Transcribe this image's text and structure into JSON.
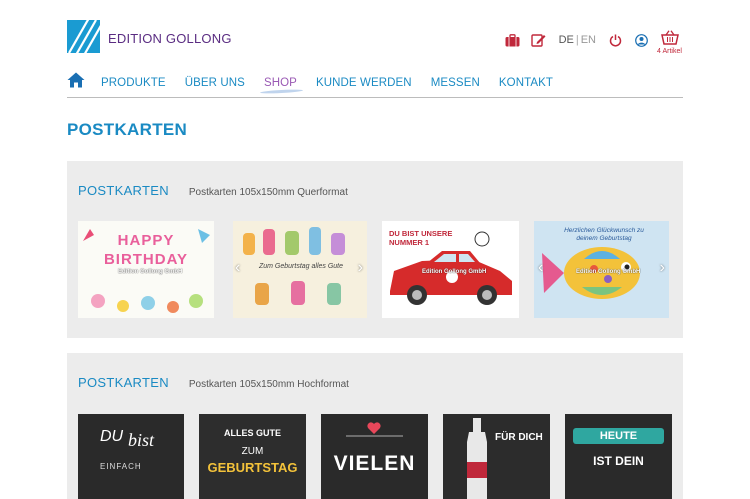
{
  "brand": {
    "name": "EDITION GOLLONG"
  },
  "header": {
    "lang_active": "DE",
    "lang_sep": "|",
    "lang_inactive": "EN",
    "cart_count": "4 Artikel"
  },
  "nav": {
    "items": [
      {
        "label": "PRODUKTE"
      },
      {
        "label": "ÜBER UNS"
      },
      {
        "label": "SHOP"
      },
      {
        "label": "KUNDE WERDEN"
      },
      {
        "label": "MESSEN"
      },
      {
        "label": "KONTAKT"
      }
    ]
  },
  "page": {
    "title": "POSTKARTEN"
  },
  "sections": [
    {
      "title": "POSTKARTEN",
      "subtitle": "Postkarten 105x150mm Querformat",
      "cards": [
        {
          "text": "HAPPY BIRTHDAY",
          "watermark": "Edition Gollong GmbH"
        },
        {
          "text": "Zum Geburtstag alles Gute",
          "watermark": "Edition Gollong GmbH"
        },
        {
          "text": "DU BIST UNSERE NUMMER 1",
          "watermark": "Edition Gollong GmbH"
        },
        {
          "text": "Herzlichen Glückwunsch zu deinem Geburtstag",
          "watermark": "Edition Gollong GmbH"
        }
      ]
    },
    {
      "title": "POSTKARTEN",
      "subtitle": "Postkarten 105x150mm Hochformat",
      "cards": [
        {
          "text1": "DU",
          "text2": "bist",
          "text3": "EINFACH"
        },
        {
          "text1": "ALLES GUTE",
          "text2": "ZUM",
          "text3": "GEBURTSTAG"
        },
        {
          "text1": "VIELEN"
        },
        {
          "text1": "FÜR DICH"
        },
        {
          "text1": "HEUTE",
          "text2": "IST DEIN"
        }
      ]
    }
  ],
  "colors": {
    "brand_blue": "#1a8ac3",
    "brand_purple": "#5a2c82",
    "accent_red": "#c0283b",
    "panel": "#ececec"
  }
}
